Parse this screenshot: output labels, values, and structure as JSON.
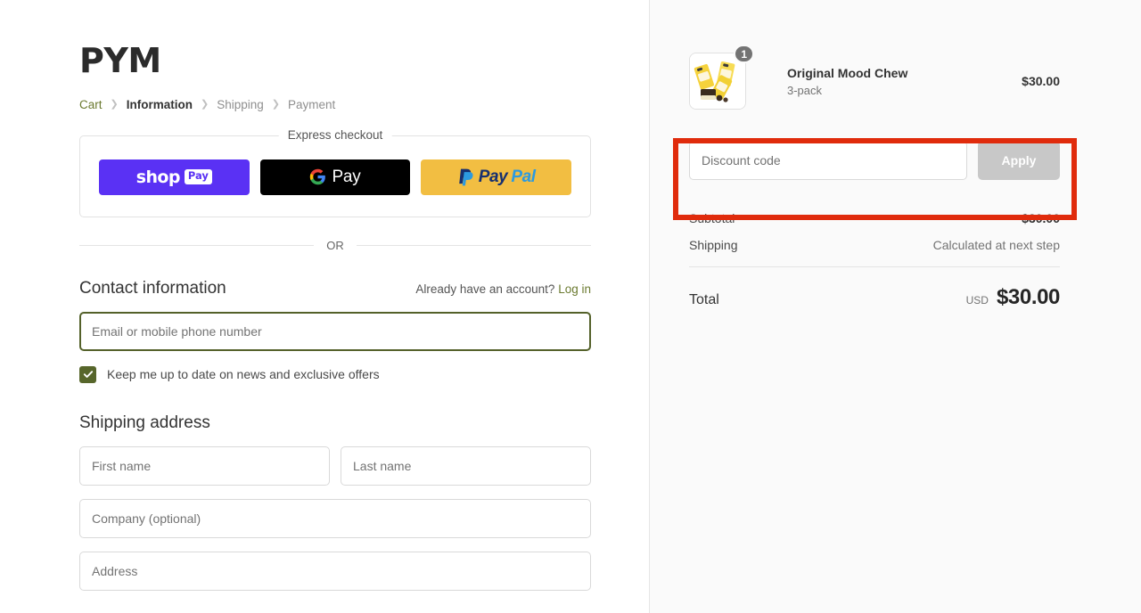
{
  "brand": {
    "logo_text": "PYM",
    "accent_olive": "#6b7a30",
    "focus_border": "#54612a",
    "highlight_red": "#e02b0c"
  },
  "breadcrumb": {
    "separator": "❯",
    "items": [
      {
        "label": "Cart",
        "state": "link"
      },
      {
        "label": "Information",
        "state": "current"
      },
      {
        "label": "Shipping",
        "state": "upcoming"
      },
      {
        "label": "Payment",
        "state": "upcoming"
      }
    ]
  },
  "express": {
    "legend": "Express checkout",
    "buttons": [
      {
        "name": "shop-pay",
        "word1": "shop",
        "word2": "Pay",
        "bg": "#5a31f4"
      },
      {
        "name": "google-pay",
        "word1": "G",
        "word2": "Pay",
        "bg": "#000000"
      },
      {
        "name": "paypal",
        "word1": "Pay",
        "word2": "Pal",
        "bg": "#f2be42"
      }
    ]
  },
  "divider": {
    "or_label": "OR"
  },
  "contact": {
    "title": "Contact information",
    "account_prompt": "Already have an account?",
    "login_label": "Log in",
    "email_placeholder": "Email or mobile phone number",
    "email_value": "",
    "newsletter_label": "Keep me up to date on news and exclusive offers",
    "newsletter_checked": true
  },
  "shipping_address": {
    "title": "Shipping address",
    "fields": [
      {
        "name": "first-name",
        "placeholder": "First name",
        "value": ""
      },
      {
        "name": "last-name",
        "placeholder": "Last name",
        "value": ""
      },
      {
        "name": "company",
        "placeholder": "Company (optional)",
        "value": ""
      },
      {
        "name": "address",
        "placeholder": "Address",
        "value": ""
      }
    ]
  },
  "summary": {
    "line_items": [
      {
        "title": "Original Mood Chew",
        "variant": "3-pack",
        "quantity": "1",
        "price": "$30.00"
      }
    ],
    "discount": {
      "placeholder": "Discount code",
      "value": "",
      "apply_label": "Apply",
      "highlighted": true
    },
    "totals": [
      {
        "label": "Subtotal",
        "value": "$30.00",
        "muted": false
      },
      {
        "label": "Shipping",
        "value": "Calculated at next step",
        "muted": true
      }
    ],
    "grand_total": {
      "label": "Total",
      "currency": "USD",
      "amount": "$30.00"
    }
  }
}
